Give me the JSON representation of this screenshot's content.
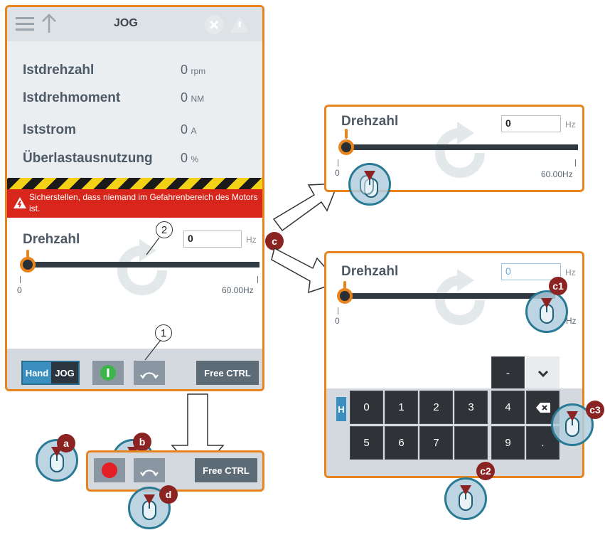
{
  "main_panel": {
    "title": "JOG",
    "rows": [
      {
        "label": "Istdrehzahl",
        "value": "0",
        "unit": "rpm"
      },
      {
        "label": "Istdrehmoment",
        "value": "0",
        "unit": "NM"
      },
      {
        "label": "Iststrom",
        "value": "0",
        "unit": "A"
      },
      {
        "label": "Überlastausnutzung",
        "value": "0",
        "unit": "%"
      }
    ],
    "warning": "Sicherstellen, dass niemand im Gefahrenbereich des Motors ist.",
    "speed_label": "Drehzahl",
    "speed_value": "0",
    "speed_unit": "Hz",
    "scale_min": "0",
    "scale_max": "60.00Hz",
    "hand_label": "Hand",
    "jog_label": "JOG",
    "free_ctrl_label": "Free CTRL"
  },
  "top_right_panel": {
    "speed_label": "Drehzahl",
    "speed_value": "0",
    "speed_unit": "Hz",
    "scale_min": "0",
    "scale_max": "60.00Hz"
  },
  "bottom_right_panel": {
    "speed_label": "Drehzahl",
    "speed_value": "0",
    "speed_unit": "Hz",
    "scale_min": "0",
    "scale_max": "Hz",
    "keypad_row1": [
      "0",
      "1",
      "2",
      "3",
      "4"
    ],
    "keypad_row2": [
      "5",
      "6",
      "7",
      "",
      "9",
      "."
    ],
    "minus_key": "-",
    "partial_tab": "H"
  },
  "bottom_panel": {
    "free_ctrl_label": "Free CTRL"
  },
  "badges": {
    "a": "a",
    "b": "b",
    "c": "c",
    "c1": "c1",
    "c2": "c2",
    "c3": "c3",
    "d": "d"
  },
  "callouts": {
    "one": "1",
    "two": "2"
  },
  "colors": {
    "accent_orange": "#e8841e",
    "warning_red": "#d9261c",
    "badge_red": "#8b2323",
    "button_gray": "#8a97a2",
    "button_dark": "#5d6b77",
    "run_green": "#3db54a",
    "stop_red": "#e31e24"
  }
}
